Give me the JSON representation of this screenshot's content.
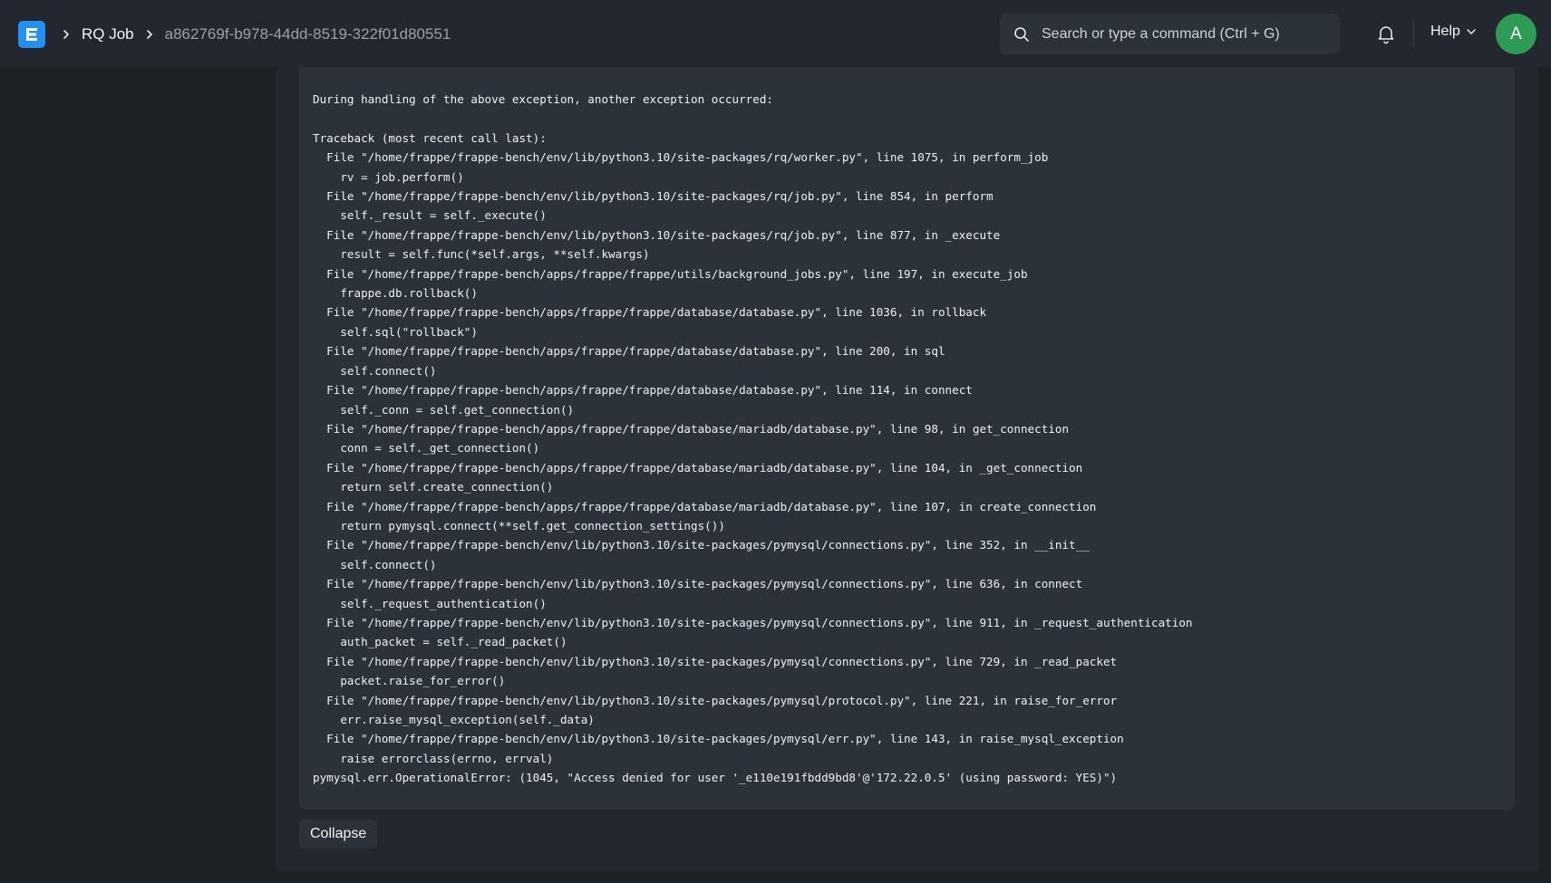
{
  "navbar": {
    "logo_letter": "E",
    "breadcrumb": {
      "doctype": "RQ Job",
      "current": "a862769f-b978-44dd-8519-322f01d80551"
    },
    "search": {
      "placeholder": "Search or type a command (Ctrl + G)",
      "value": ""
    },
    "notifications_icon": "bell-icon",
    "help_label": "Help",
    "avatar_letter": "A"
  },
  "traceback": {
    "lines": [
      "During handling of the above exception, another exception occurred:",
      "",
      "Traceback (most recent call last):",
      "  File \"/home/frappe/frappe-bench/env/lib/python3.10/site-packages/rq/worker.py\", line 1075, in perform_job",
      "    rv = job.perform()",
      "  File \"/home/frappe/frappe-bench/env/lib/python3.10/site-packages/rq/job.py\", line 854, in perform",
      "    self._result = self._execute()",
      "  File \"/home/frappe/frappe-bench/env/lib/python3.10/site-packages/rq/job.py\", line 877, in _execute",
      "    result = self.func(*self.args, **self.kwargs)",
      "  File \"/home/frappe/frappe-bench/apps/frappe/frappe/utils/background_jobs.py\", line 197, in execute_job",
      "    frappe.db.rollback()",
      "  File \"/home/frappe/frappe-bench/apps/frappe/frappe/database/database.py\", line 1036, in rollback",
      "    self.sql(\"rollback\")",
      "  File \"/home/frappe/frappe-bench/apps/frappe/frappe/database/database.py\", line 200, in sql",
      "    self.connect()",
      "  File \"/home/frappe/frappe-bench/apps/frappe/frappe/database/database.py\", line 114, in connect",
      "    self._conn = self.get_connection()",
      "  File \"/home/frappe/frappe-bench/apps/frappe/frappe/database/mariadb/database.py\", line 98, in get_connection",
      "    conn = self._get_connection()",
      "  File \"/home/frappe/frappe-bench/apps/frappe/frappe/database/mariadb/database.py\", line 104, in _get_connection",
      "    return self.create_connection()",
      "  File \"/home/frappe/frappe-bench/apps/frappe/frappe/database/mariadb/database.py\", line 107, in create_connection",
      "    return pymysql.connect(**self.get_connection_settings())",
      "  File \"/home/frappe/frappe-bench/env/lib/python3.10/site-packages/pymysql/connections.py\", line 352, in __init__",
      "    self.connect()",
      "  File \"/home/frappe/frappe-bench/env/lib/python3.10/site-packages/pymysql/connections.py\", line 636, in connect",
      "    self._request_authentication()",
      "  File \"/home/frappe/frappe-bench/env/lib/python3.10/site-packages/pymysql/connections.py\", line 911, in _request_authentication",
      "    auth_packet = self._read_packet()",
      "  File \"/home/frappe/frappe-bench/env/lib/python3.10/site-packages/pymysql/connections.py\", line 729, in _read_packet",
      "    packet.raise_for_error()",
      "  File \"/home/frappe/frappe-bench/env/lib/python3.10/site-packages/pymysql/protocol.py\", line 221, in raise_for_error",
      "    err.raise_mysql_exception(self._data)",
      "  File \"/home/frappe/frappe-bench/env/lib/python3.10/site-packages/pymysql/err.py\", line 143, in raise_mysql_exception",
      "    raise errorclass(errno, errval)",
      "pymysql.err.OperationalError: (1045, \"Access denied for user '_e110e191fbdd9bd8'@'172.22.0.5' (using password: YES)\")"
    ]
  },
  "collapse_label": "Collapse",
  "colors": {
    "background": "#1c2126",
    "navbar": "#232830",
    "code_block": "#2c323a",
    "brand": "#2490ef",
    "avatar": "#2e9c55"
  }
}
